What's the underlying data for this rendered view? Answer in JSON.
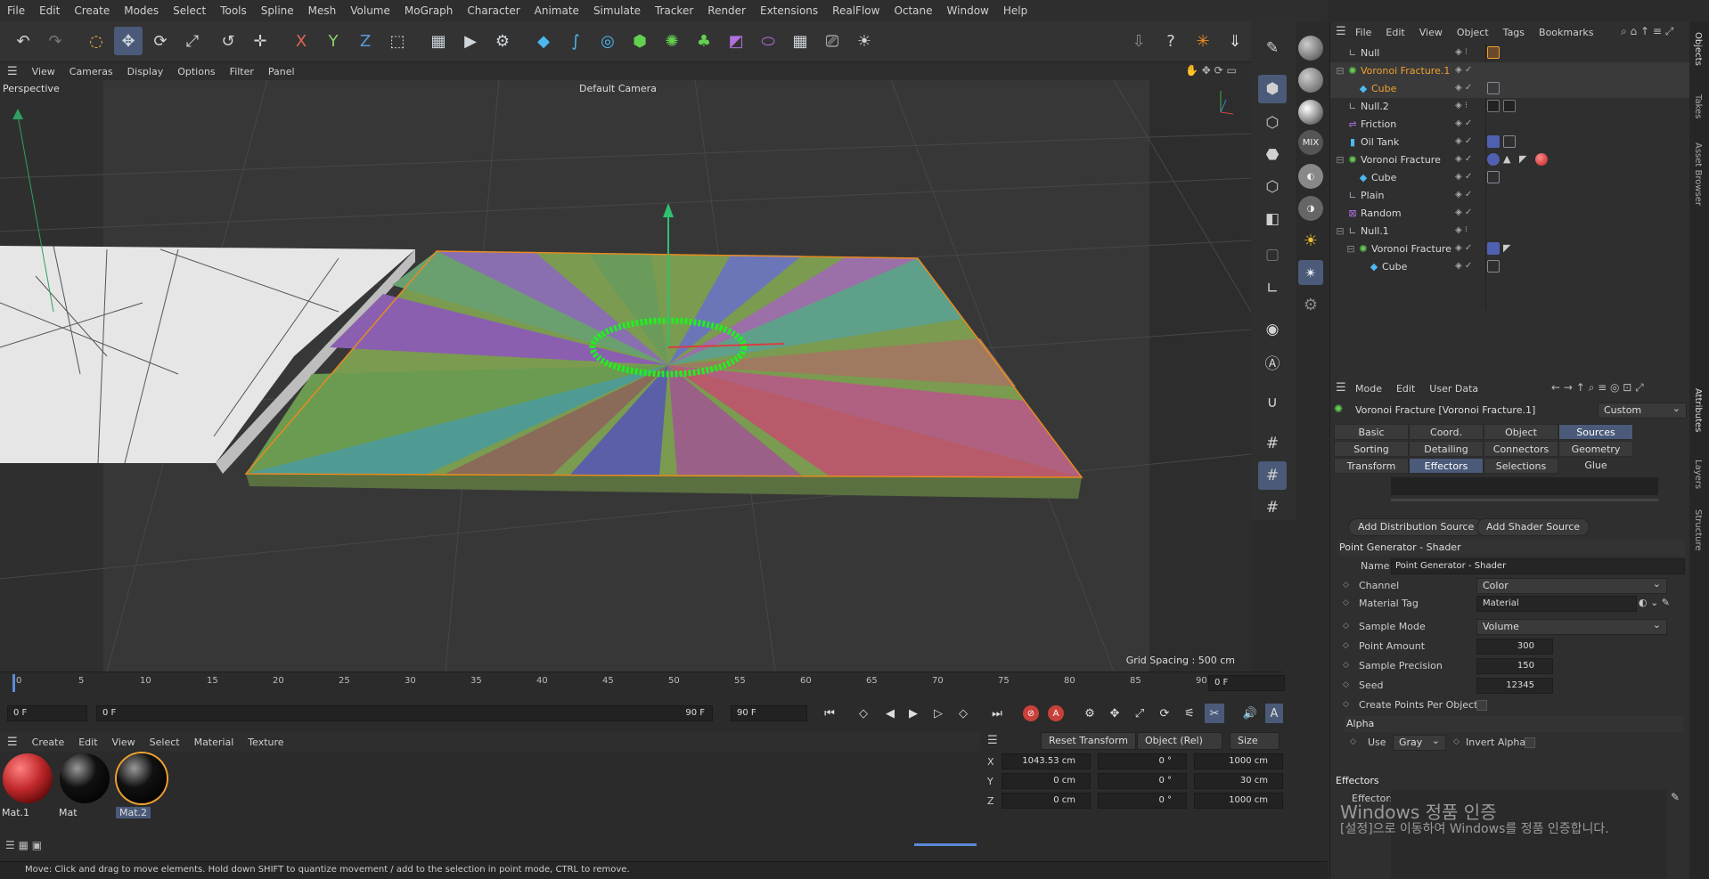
{
  "menubar": [
    "File",
    "Edit",
    "Create",
    "Modes",
    "Select",
    "Tools",
    "Spline",
    "Mesh",
    "Volume",
    "MoGraph",
    "Character",
    "Animate",
    "Simulate",
    "Tracker",
    "Render",
    "Extensions",
    "RealFlow",
    "Octane",
    "Window",
    "Help"
  ],
  "viewport": {
    "menu": [
      "View",
      "Cameras",
      "Display",
      "Options",
      "Filter",
      "Panel"
    ],
    "projection": "Perspective",
    "camera": "Default Camera",
    "grid_spacing": "Grid Spacing : 500 cm"
  },
  "timeline": {
    "ticks": [
      "0",
      "5",
      "10",
      "15",
      "20",
      "25",
      "30",
      "35",
      "40",
      "45",
      "50",
      "55",
      "60",
      "65",
      "70",
      "75",
      "80",
      "85",
      "90"
    ],
    "current_frame": "0 F",
    "start_frame": "0 F",
    "range_start": "0 F",
    "range_end": "90 F",
    "end_frame": "90 F"
  },
  "materials": {
    "menu": [
      "Create",
      "Edit",
      "View",
      "Select",
      "Material",
      "Texture"
    ],
    "items": [
      {
        "name": "Mat.1",
        "color": "#c0282a"
      },
      {
        "name": "Mat",
        "color": "#111111"
      },
      {
        "name": "Mat.2",
        "color": "#111111"
      }
    ]
  },
  "coords": {
    "reset_label": "Reset Transform",
    "mode": "Object (Rel)",
    "size_mode": "Size",
    "rows": [
      {
        "axis": "X",
        "pos": "1043.53 cm",
        "rot": "0 °",
        "size": "1000 cm"
      },
      {
        "axis": "Y",
        "pos": "0 cm",
        "rot": "0 °",
        "size": "30 cm"
      },
      {
        "axis": "Z",
        "pos": "0 cm",
        "rot": "0 °",
        "size": "1000 cm"
      }
    ]
  },
  "status": "Move: Click and drag to move elements. Hold down SHIFT to quantize movement / add to the selection in point mode, CTRL to remove.",
  "objects": {
    "menu": [
      "File",
      "Edit",
      "View",
      "Object",
      "Tags",
      "Bookmarks"
    ],
    "items": [
      {
        "name": "Null",
        "icon": "null-icon",
        "selected": false
      },
      {
        "name": "Voronoi Fracture.1",
        "icon": "voronoi-icon",
        "selected": true
      },
      {
        "name": "Cube",
        "icon": "cube-icon",
        "selected": true
      },
      {
        "name": "Null.2",
        "icon": "null-icon",
        "selected": false
      },
      {
        "name": "Friction",
        "icon": "friction-icon",
        "selected": false
      },
      {
        "name": "Oil Tank",
        "icon": "cylinder-icon",
        "selected": false
      },
      {
        "name": "Voronoi Fracture",
        "icon": "voronoi-icon",
        "selected": false
      },
      {
        "name": "Cube",
        "icon": "cube-icon",
        "selected": false
      },
      {
        "name": "Plain",
        "icon": "plain-icon",
        "selected": false
      },
      {
        "name": "Random",
        "icon": "random-icon",
        "selected": false
      },
      {
        "name": "Null.1",
        "icon": "null-icon",
        "selected": false
      },
      {
        "name": "Voronoi Fracture",
        "icon": "voronoi-icon",
        "selected": false
      },
      {
        "name": "Cube",
        "icon": "cube-icon",
        "selected": false
      }
    ]
  },
  "attributes": {
    "menu": [
      "Mode",
      "Edit",
      "User Data"
    ],
    "title": "Voronoi Fracture [Voronoi Fracture.1]",
    "preset": "Custom",
    "tabs": [
      "Basic",
      "Coord.",
      "Object",
      "Sources",
      "Sorting",
      "Detailing",
      "Connectors",
      "Geometry Glue",
      "Transform",
      "Effectors",
      "Selections"
    ],
    "add_distribution": "Add Distribution Source",
    "add_shader": "Add Shader Source",
    "section": "Point Generator - Shader",
    "name_label": "Name",
    "name_value": "Point Generator - Shader",
    "channel_label": "Channel",
    "channel_value": "Color",
    "material_tag_label": "Material Tag",
    "material_tag_value": "Material",
    "sample_mode_label": "Sample Mode",
    "sample_mode_value": "Volume",
    "point_amount_label": "Point Amount",
    "point_amount_value": "300",
    "sample_precision_label": "Sample Precision",
    "sample_precision_value": "150",
    "seed_label": "Seed",
    "seed_value": "12345",
    "create_points_label": "Create Points Per Object",
    "alpha_section": "Alpha",
    "use_label": "Use",
    "use_value": "Gray",
    "invert_alpha_label": "Invert Alpha",
    "effectors_section": "Effectors",
    "effectors_label": "Effectors"
  },
  "sidetabs": [
    "Objects",
    "Takes",
    "Asset Browser",
    "Attributes",
    "Layers",
    "Structure"
  ],
  "watermark": {
    "line1": "Windows 정품 인증",
    "line2": "[설정]으로 이동하여 Windows를 정품 인증합니다."
  }
}
